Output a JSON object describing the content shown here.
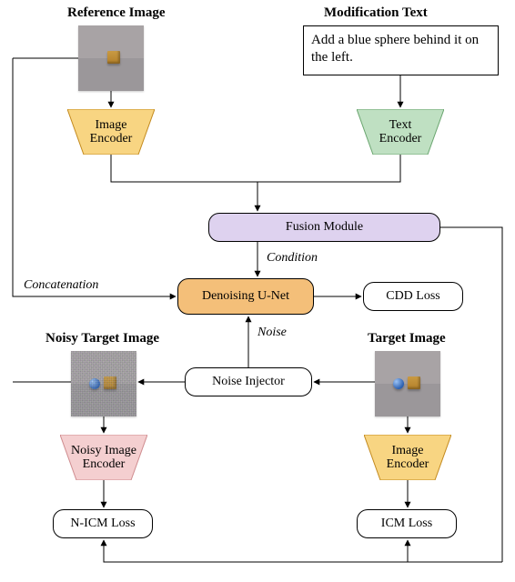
{
  "headings": {
    "reference_image": "Reference Image",
    "modification_text": "Modification Text",
    "noisy_target_image": "Noisy Target Image",
    "target_image": "Target Image"
  },
  "mod_text": "Add a blue sphere behind it on the left.",
  "encoders": {
    "image_encoder": "Image\nEncoder",
    "text_encoder": "Text\nEncoder",
    "noisy_image_encoder": "Noisy Image\nEncoder",
    "target_image_encoder": "Image\nEncoder"
  },
  "blocks": {
    "fusion_module": "Fusion Module",
    "denoising_unet": "Denoising U-Net",
    "noise_injector": "Noise Injector"
  },
  "losses": {
    "cdd": "CDD Loss",
    "nicm": "N-ICM Loss",
    "icm": "ICM Loss"
  },
  "edge_labels": {
    "concatenation": "Concatenation",
    "condition": "Condition",
    "noise": "Noise"
  },
  "colors": {
    "image_encoder_fill": "#f8d582",
    "image_encoder_stroke": "#c38a1f",
    "text_encoder_fill": "#bfe0c2",
    "text_encoder_stroke": "#6aa56f",
    "noisy_encoder_fill": "#f4cfd0",
    "noisy_encoder_stroke": "#cf8c8f",
    "fusion_fill": "#ded2ef",
    "unet_fill": "#f4bf79"
  },
  "diagram": {
    "nodes": [
      {
        "id": "ref_img",
        "type": "image",
        "label": "Reference Image"
      },
      {
        "id": "mod_txt",
        "type": "text-box",
        "label": "Modification Text"
      },
      {
        "id": "img_enc",
        "type": "encoder",
        "label": "Image Encoder"
      },
      {
        "id": "txt_enc",
        "type": "encoder",
        "label": "Text Encoder"
      },
      {
        "id": "fusion",
        "type": "module",
        "label": "Fusion Module"
      },
      {
        "id": "unet",
        "type": "module",
        "label": "Denoising U-Net"
      },
      {
        "id": "cdd_loss",
        "type": "loss",
        "label": "CDD Loss"
      },
      {
        "id": "noise_inj",
        "type": "module",
        "label": "Noise Injector"
      },
      {
        "id": "target_img",
        "type": "image",
        "label": "Target Image"
      },
      {
        "id": "noisy_img",
        "type": "image",
        "label": "Noisy Target Image"
      },
      {
        "id": "noisy_enc",
        "type": "encoder",
        "label": "Noisy Image Encoder"
      },
      {
        "id": "target_enc",
        "type": "encoder",
        "label": "Image Encoder"
      },
      {
        "id": "nicm_loss",
        "type": "loss",
        "label": "N-ICM Loss"
      },
      {
        "id": "icm_loss",
        "type": "loss",
        "label": "ICM Loss"
      }
    ],
    "edges": [
      {
        "from": "ref_img",
        "to": "img_enc"
      },
      {
        "from": "mod_txt",
        "to": "txt_enc"
      },
      {
        "from": "img_enc",
        "to": "fusion"
      },
      {
        "from": "txt_enc",
        "to": "fusion"
      },
      {
        "from": "fusion",
        "to": "unet",
        "label": "Condition"
      },
      {
        "from": "ref_img_feat_line",
        "to": "unet",
        "label": "Concatenation"
      },
      {
        "from": "unet",
        "to": "cdd_loss"
      },
      {
        "from": "target_img",
        "to": "noise_inj"
      },
      {
        "from": "noise_inj",
        "to": "noisy_img"
      },
      {
        "from": "noise_inj",
        "to": "unet",
        "label": "Noise"
      },
      {
        "from": "noisy_img",
        "to": "noisy_enc"
      },
      {
        "from": "target_img",
        "to": "target_enc"
      },
      {
        "from": "noisy_enc",
        "to": "nicm_loss"
      },
      {
        "from": "target_enc",
        "to": "icm_loss"
      },
      {
        "from": "fusion",
        "to": "nicm_loss"
      },
      {
        "from": "fusion",
        "to": "icm_loss"
      }
    ]
  }
}
